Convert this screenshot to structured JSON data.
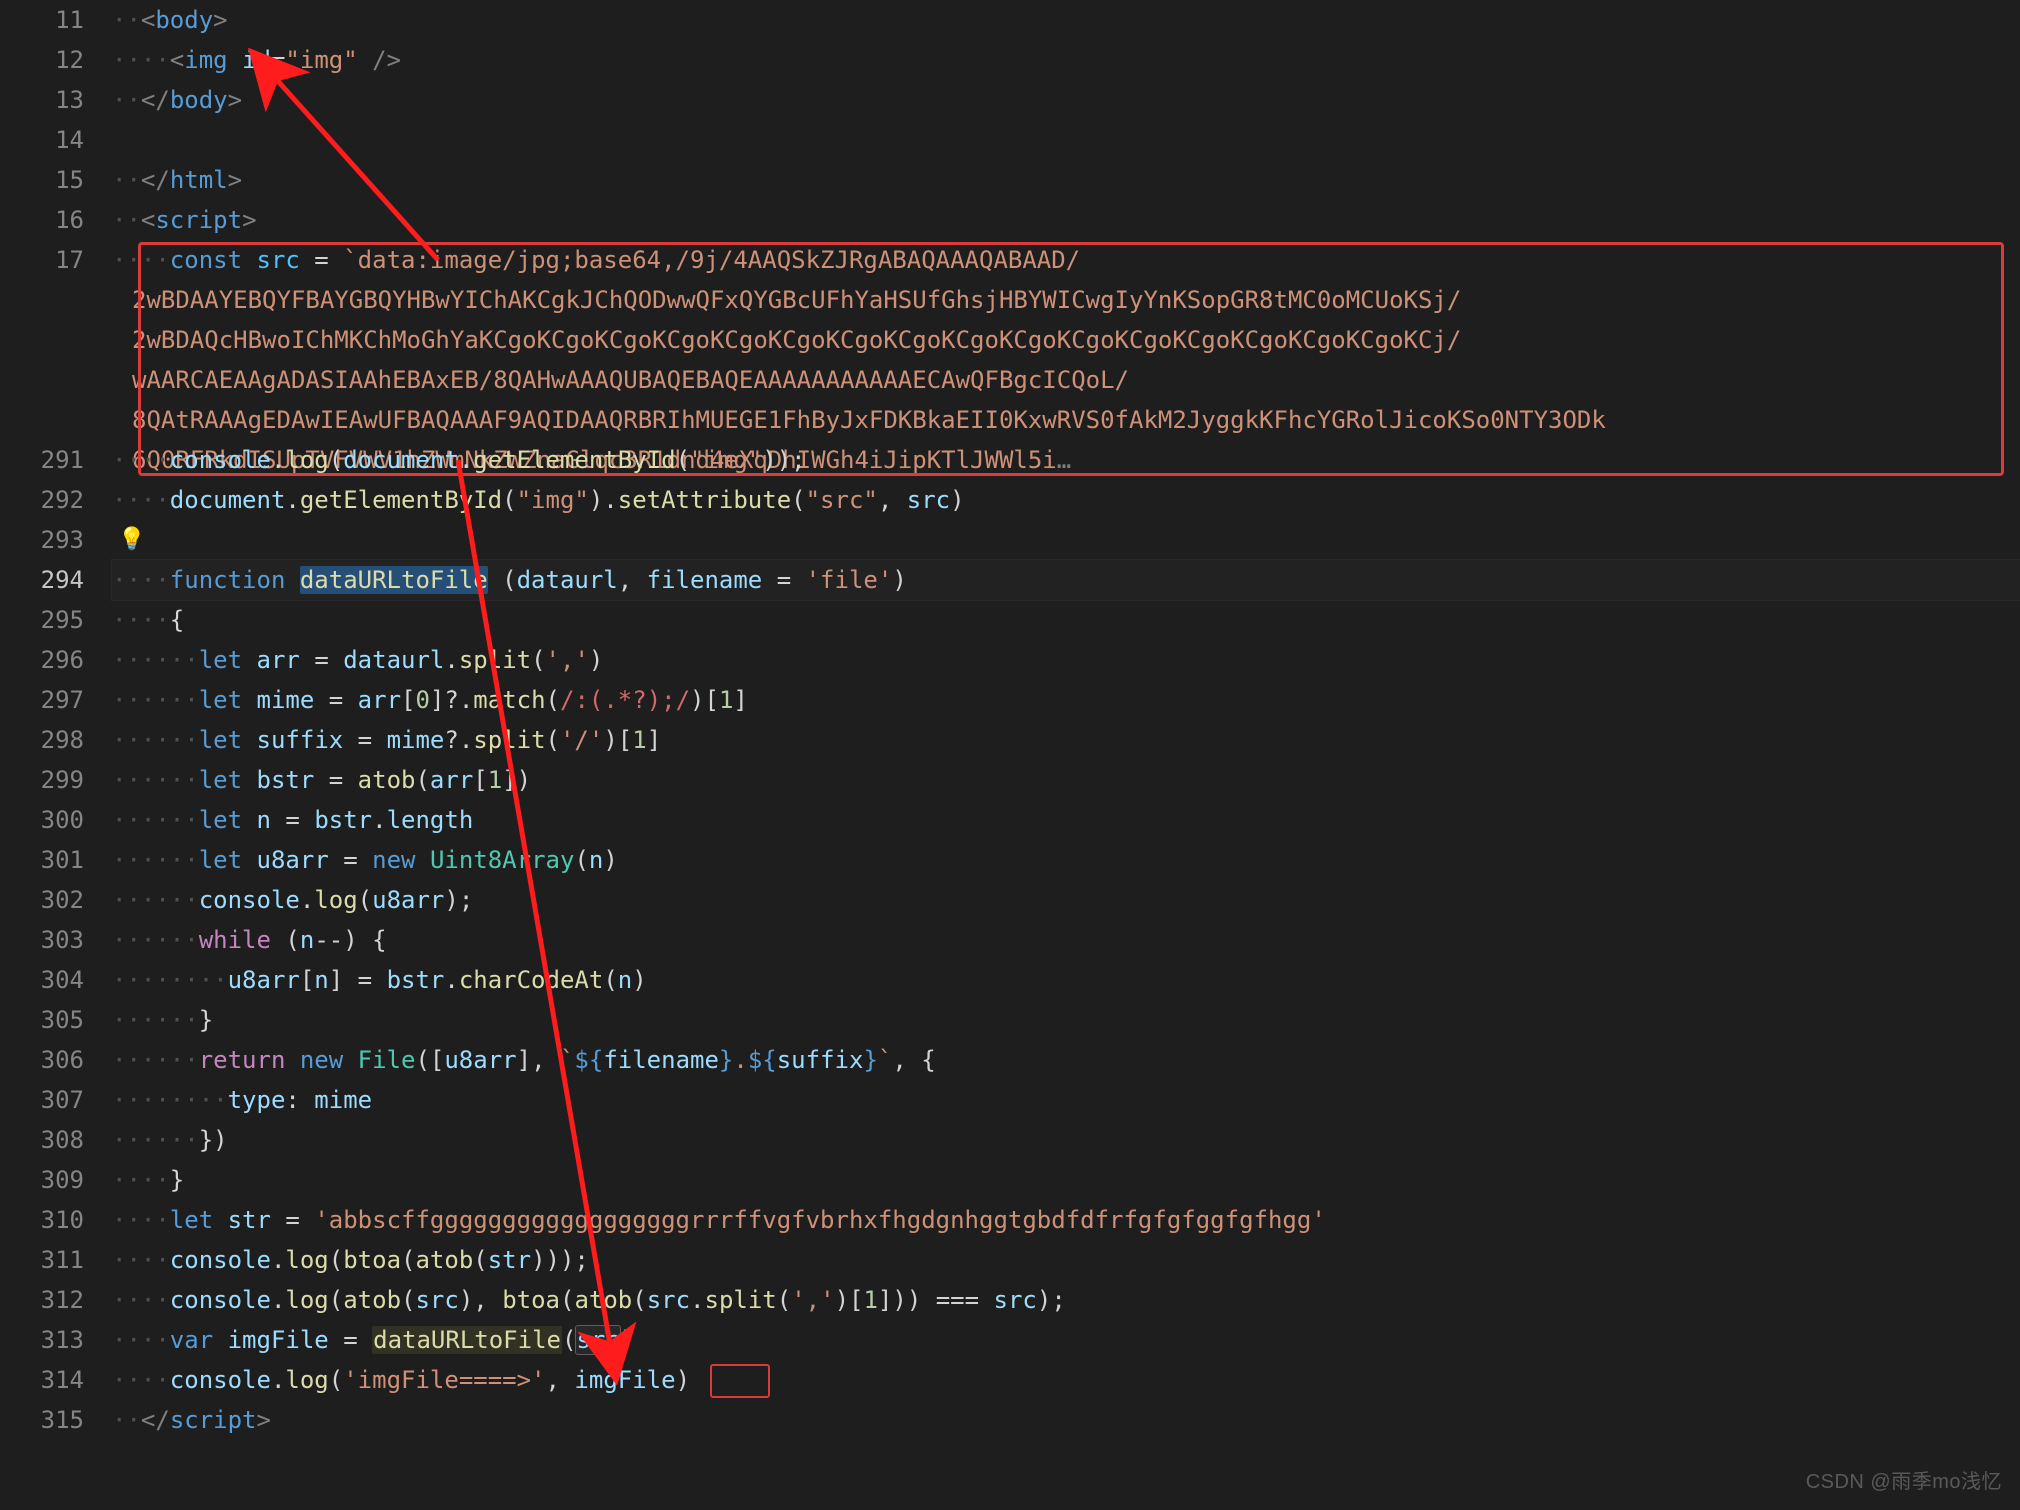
{
  "watermark": "CSDN @雨季mo浅忆",
  "gutter": {
    "lines": [
      "11",
      "12",
      "13",
      "14",
      "15",
      "16",
      "17",
      "",
      "",
      "",
      "",
      "291",
      "292",
      "293",
      "294",
      "295",
      "296",
      "297",
      "298",
      "299",
      "300",
      "301",
      "302",
      "303",
      "304",
      "305",
      "306",
      "307",
      "308",
      "309",
      "310",
      "311",
      "312",
      "313",
      "314",
      "315"
    ],
    "active_index": 14,
    "fold_row_index": 6
  },
  "code": {
    "l11": {
      "open": "<",
      "tag": "body",
      "close": ">"
    },
    "l12": {
      "open": "<",
      "tag": "img",
      "attr": "id",
      "eq": "=",
      "val": "\"img\"",
      "selfclose": " />"
    },
    "l13": {
      "open": "</",
      "tag": "body",
      "close": ">"
    },
    "l15": {
      "open": "</",
      "tag": "html",
      "close": ">"
    },
    "l16": {
      "open": "<",
      "tag": "script",
      "close": ">"
    },
    "l17": {
      "kw": "const",
      "var": "src",
      "op": " = ",
      "tick": "`",
      "s0": "data:image/jpg;base64,/9j/4AAQSkZJRgABAQAAAQABAAD/",
      "s1": "2wBDAAYEBQYFBAYGBQYHBwYIChAKCgkJChQODwwQFxQYGBcUFhYaHSUfGhsjHBYWICwgIyYnKSopGR8tMC0oMCUoKSj/",
      "s2": "2wBDAQcHBwoIChMKChMoGhYaKCgoKCgoKCgoKCgoKCgoKCgoKCgoKCgoKCgoKCgoKCgoKCgoKCgoKCgoKCgoKCgoKCj/",
      "s3": "wAARCAEAAgADASIAAhEBAxEB/8QAHwAAAQUBAQEBAQEAAAAAAAAAAAECAwQFBgcICQoL/",
      "s4": "8QAtRAAAgEDAwIEAwUFBAQAAAF9AQIDAAQRBRIhMUEGE1FhByJxFDKBkaEII0KxwRVS0fAkM2JyggkKFhcYGRolJicoKSo0NTY3ODk",
      "s5": "6Q0RFRkdISUpTVFVWV1hZWmNkZWZnaGlqc3R1dnd4eXqDhIWGh4iJipKTlJWWl5i",
      "ell": "…"
    },
    "l291": {
      "obj": "console",
      "dot": ".",
      "fn": "log",
      "open": "(",
      "d": "document",
      "d2": ".",
      "g": "getElementById",
      "p": "(",
      "arg": "\"img\"",
      "close": "));"
    },
    "l292": {
      "d": "document",
      "dot": ".",
      "g": "getElementById",
      "open": "(",
      "arg": "\"img\"",
      "close": ")",
      "dot2": ".",
      "set": "setAttribute",
      "open2": "(",
      "a1": "\"src\"",
      "comma": ", ",
      "v": "src",
      "close2": ")"
    },
    "l294": {
      "kw": "function",
      "name": "dataURLtoFile",
      "sp": " ",
      "open": "(",
      "p1": "dataurl",
      "comma": ", ",
      "p2": "filename",
      "eq": " = ",
      "def": "'file'",
      "close": ")"
    },
    "l295": {
      "brace": "{"
    },
    "l296": {
      "kw": "let",
      "v": "arr",
      "eq": " = ",
      "obj": "dataurl",
      "dot": ".",
      "fn": "split",
      "open": "(",
      "arg": "','",
      "close": ")"
    },
    "l297": {
      "kw": "let",
      "v": "mime",
      "eq": " = ",
      "arr": "arr",
      "b": "[",
      "i": "0",
      "b2": "]",
      "opt": "?.",
      "fn": "match",
      "open": "(",
      "rx": "/:(.*?);/",
      "close": ")",
      "b3": "[",
      "i2": "1",
      "b4": "]"
    },
    "l298": {
      "kw": "let",
      "v": "suffix",
      "eq": " = ",
      "m": "mime",
      "opt": "?.",
      "fn": "split",
      "open": "(",
      "arg": "'/'",
      "close": ")",
      "b": "[",
      "i": "1",
      "b2": "]"
    },
    "l299": {
      "kw": "let",
      "v": "bstr",
      "eq": " = ",
      "fn": "atob",
      "open": "(",
      "arr": "arr",
      "b": "[",
      "i": "1",
      "b2": "]",
      ")": ")"
    },
    "l300": {
      "kw": "let",
      "v": "n",
      "eq": " = ",
      "b": "bstr",
      "dot": ".",
      "p": "length"
    },
    "l301": {
      "kw": "let",
      "v": "u8arr",
      "eq": " = ",
      "new": "new",
      "ty": "Uint8Array",
      "open": "(",
      "arg": "n",
      "close": ")"
    },
    "l302": {
      "obj": "console",
      "dot": ".",
      "fn": "log",
      "open": "(",
      "arg": "u8arr",
      "close": ");"
    },
    "l303": {
      "kw": "while",
      "open": " (",
      "v": "n",
      "op": "--",
      ") ": ") ",
      "brace": "{"
    },
    "l304": {
      "arr": "u8arr",
      "b": "[",
      "i": "n",
      "b2": "]",
      "eq": " = ",
      "bs": "bstr",
      "dot": ".",
      "fn": "charCodeAt",
      "open": "(",
      "arg": "n",
      "close": ")"
    },
    "l305": {
      "brace": "}"
    },
    "l306": {
      "kw": "return",
      "new": " new",
      "ty": " File",
      "open": "(",
      "b": "[",
      "a": "u8arr",
      "b2": "]",
      "comma": ", ",
      "tick": "`",
      "tpl1": "${",
      "f": "filename",
      "tplc": "}",
      "dot": ".",
      "tpl2": "${",
      "s": "suffix",
      "tplc2": "}",
      "tick2": "`",
      "comma2": ", ",
      "brace": "{"
    },
    "l307": {
      "prop": "type",
      "colon": ": ",
      "v": "mime"
    },
    "l308": {
      "brace": "})"
    },
    "l309": {
      "brace": "}"
    },
    "l310": {
      "kw": "let",
      "v": "str",
      "eq": " = ",
      "s": "'abbscffggggggggggggggggggrrrffvgfvbrhxfhgdgnhggtgbdfdfrfgfgfggfgfhgg'"
    },
    "l311": {
      "obj": "console",
      "dot": ".",
      "fn": "log",
      "open": "(",
      "f1": "btoa",
      "o1": "(",
      "f2": "atob",
      "o2": "(",
      "arg": "str",
      "close": ")));"
    },
    "l312": {
      "obj": "console",
      "dot": ".",
      "fn": "log",
      "open": "(",
      "f1": "atob",
      "o1": "(",
      "a1": "src",
      "c1": ")",
      "comma": ", ",
      "f2": "btoa",
      "o2": "(",
      "f3": "atob",
      "o3": "(",
      "a2": "src",
      "d2": ".",
      "sp": "split",
      "o4": "(",
      "sa": "','",
      "c4": ")",
      "br": "[",
      "i": "1",
      "br2": "]",
      "c3": "))",
      "op": " === ",
      "a3": "src",
      "close": ");"
    },
    "l313": {
      "kw": "var",
      "v": "imgFile",
      "eq": " = ",
      "fn": "dataURLtoFile",
      "open": "(",
      "arg": "src",
      "close": ")"
    },
    "l314": {
      "obj": "console",
      "dot": ".",
      "fn": "log",
      "open": "(",
      "s": "'imgFile====>'",
      "comma": ", ",
      "v": "imgFile",
      "close": ")"
    },
    "l315": {
      "open": "</",
      "tag": "script",
      "close": ">"
    }
  }
}
